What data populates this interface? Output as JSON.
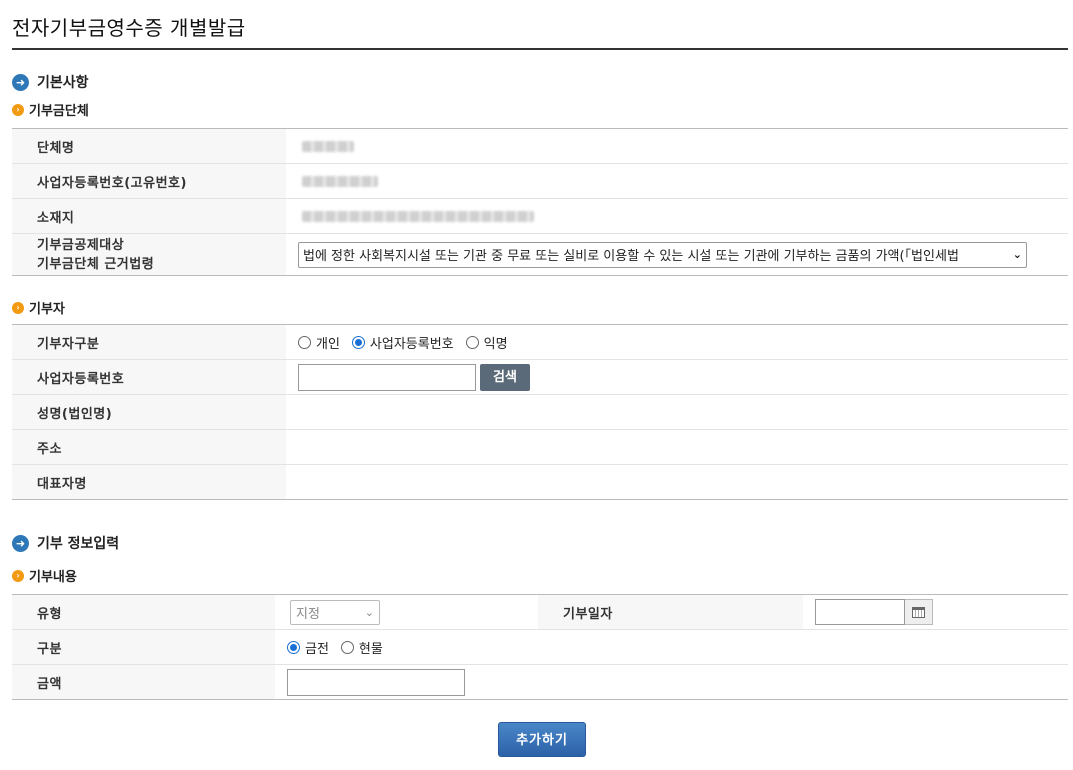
{
  "page": {
    "title": "전자기부금영수증 개별발급"
  },
  "basic": {
    "heading": "기본사항",
    "group_heading": "기부금단체",
    "org_name_label": "단체명",
    "biz_no_label": "사업자등록번호(고유번호)",
    "address_label": "소재지",
    "law_label_line1": "기부금공제대상",
    "law_label_line2": "기부금단체 근거법령",
    "law_selected": "법에 정한 사회복지시설 또는 기관 중 무료 또는 실비로 이용할 수 있는 시설 또는 기관에 기부하는 금품의 가액(「법인세법"
  },
  "donor": {
    "heading": "기부자",
    "type_label": "기부자구분",
    "type_options": [
      "개인",
      "사업자등록번호",
      "익명"
    ],
    "type_selected": "사업자등록번호",
    "biz_no_label": "사업자등록번호",
    "search_button": "검색",
    "name_label": "성명(법인명)",
    "address_label": "주소",
    "rep_label": "대표자명"
  },
  "donation": {
    "heading": "기부 정보입력",
    "group_heading": "기부내용",
    "type_label": "유형",
    "type_selected": "지정",
    "date_label": "기부일자",
    "category_label": "구분",
    "category_options": [
      "금전",
      "현물"
    ],
    "category_selected": "금전",
    "amount_label": "금액"
  },
  "actions": {
    "add_button": "추가하기"
  }
}
